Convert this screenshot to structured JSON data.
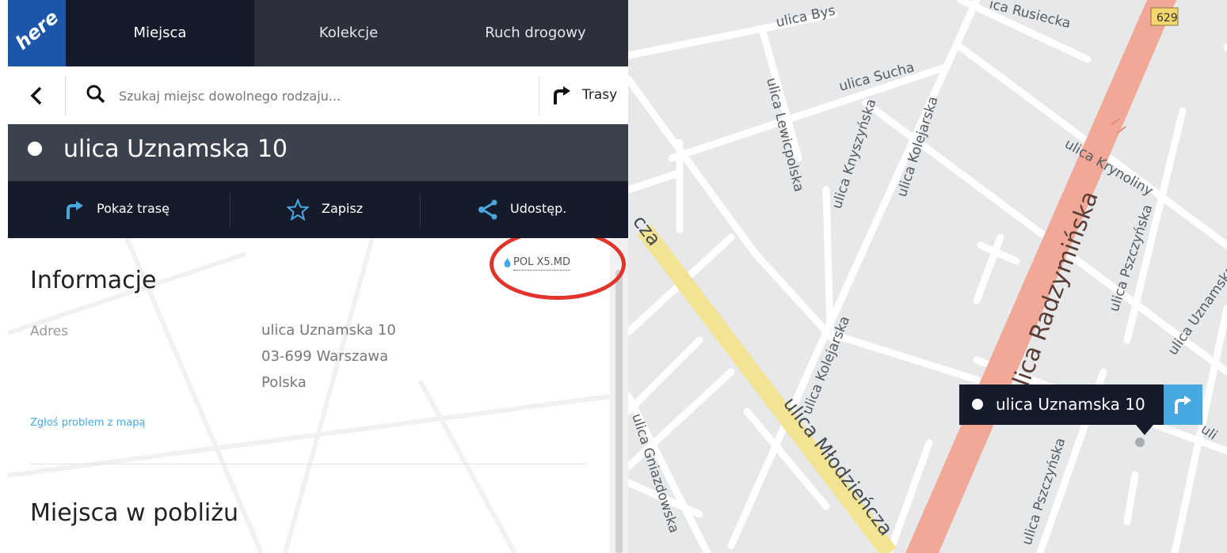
{
  "app": {
    "logo_text": "here",
    "tabs": [
      "Miejsca",
      "Kolekcje",
      "Ruch drogowy"
    ]
  },
  "search": {
    "placeholder": "Szukaj miejsc dowolnego rodzaju...",
    "routes_label": "Trasy"
  },
  "place": {
    "title": "ulica Uznamska 10",
    "actions": {
      "route": "Pokaż trasę",
      "save": "Zapisz",
      "share": "Udostęp."
    }
  },
  "info": {
    "source_label": "POL X5.MD",
    "heading": "Informacje",
    "address_label": "Adres",
    "address_lines": [
      "ulica Uznamska 10",
      "03-699 Warszawa",
      "Polska"
    ],
    "report_link": "Zgłoś problem z mapą",
    "nearby_heading": "Miejsca w pobliżu"
  },
  "map": {
    "route_shield": "629",
    "pin_label": "ulica Uznamska 10",
    "streets": {
      "bys": "ulica Bys",
      "ruskiecka": "ica Rusiecka",
      "sucha": "ulica Sucha",
      "lewicpolska": "ulica Lewicpolska",
      "knyszynska": "ulica Knyszyńska",
      "kolejarska": "ulica Kolejarska",
      "krynoliny": "ulica Krynoliny",
      "radzyminska": "ulica Radzymińska",
      "pszczynska": "ulica Pszczyńska",
      "uznamska": "ulica Uznamska",
      "mlodzienca": "ulica Młodzieńcza",
      "gniazdowska": "ulica Gniazdowska",
      "cza": "cza",
      "uli": "uli"
    }
  },
  "colors": {
    "accent": "#48a8e0",
    "header_dark": "#151b2b",
    "place_header": "#3b414d",
    "annotation": "#e0342c",
    "major_road": "#f2a896",
    "secondary_road": "#f6e89b"
  }
}
